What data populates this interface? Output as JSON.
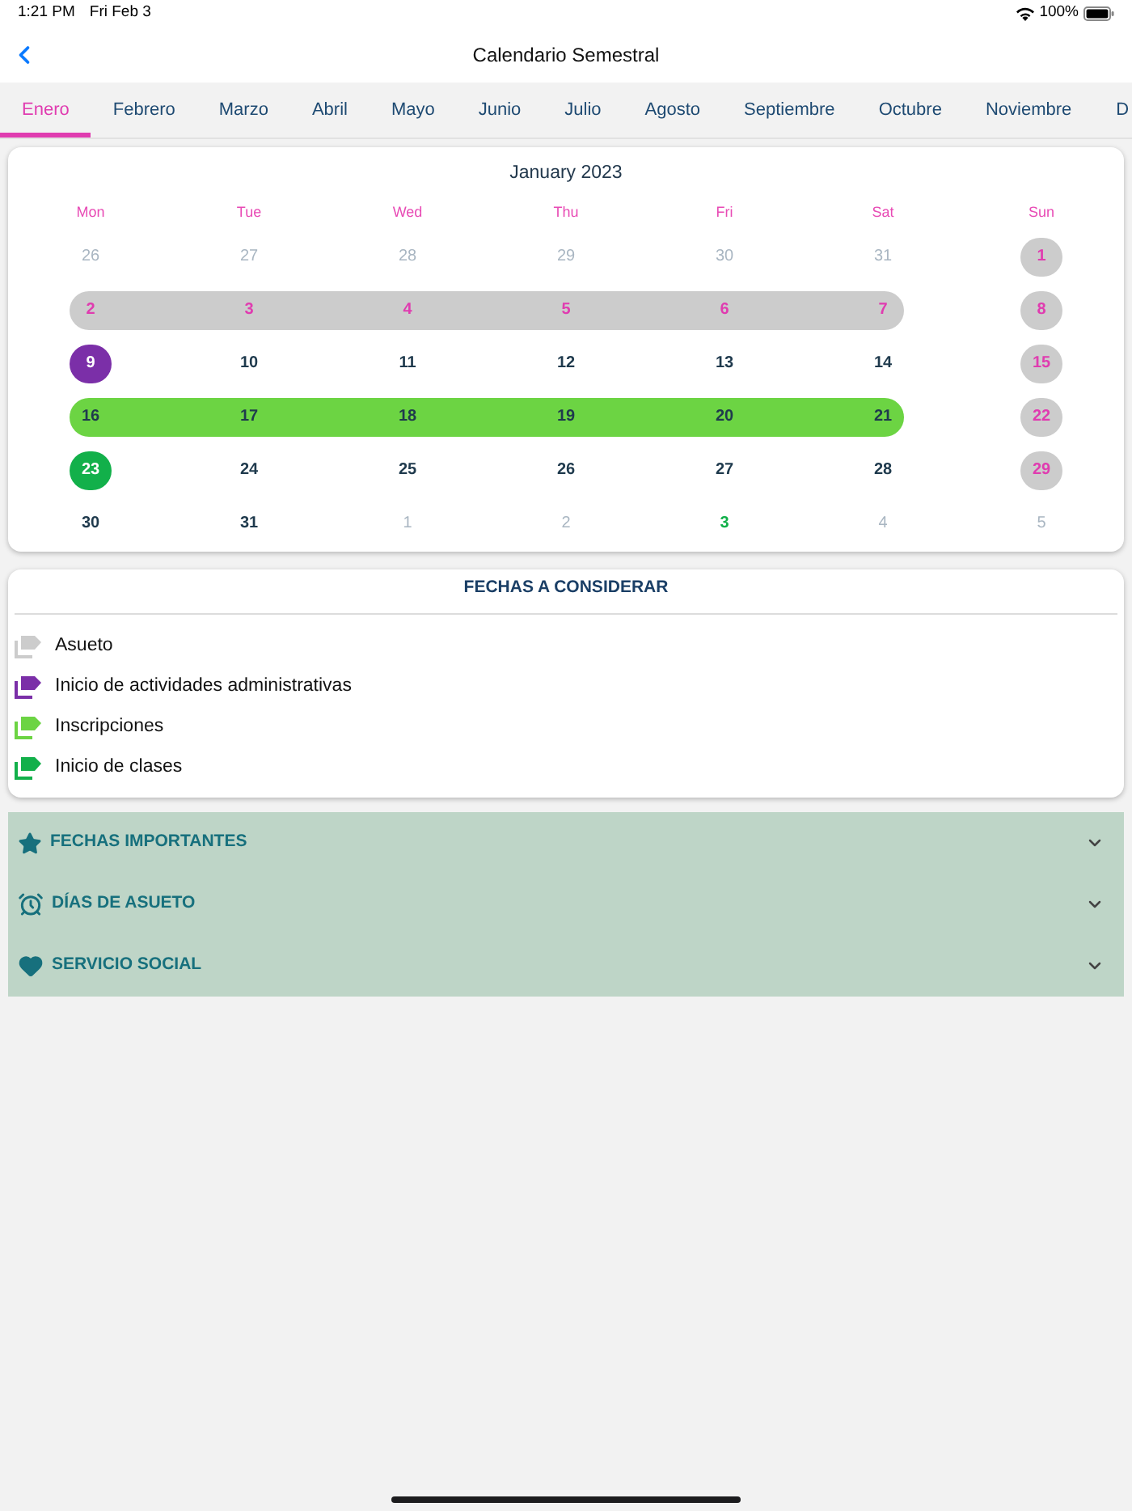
{
  "status_bar": {
    "time": "1:21 PM",
    "date": "Fri Feb 3",
    "battery": "100%"
  },
  "nav": {
    "title": "Calendario Semestral"
  },
  "tabs": [
    {
      "label": "Enero",
      "selected": true
    },
    {
      "label": "Febrero",
      "selected": false
    },
    {
      "label": "Marzo",
      "selected": false
    },
    {
      "label": "Abril",
      "selected": false
    },
    {
      "label": "Mayo",
      "selected": false
    },
    {
      "label": "Junio",
      "selected": false
    },
    {
      "label": "Julio",
      "selected": false
    },
    {
      "label": "Agosto",
      "selected": false
    },
    {
      "label": "Septiembre",
      "selected": false
    },
    {
      "label": "Octubre",
      "selected": false
    },
    {
      "label": "Noviembre",
      "selected": false
    },
    {
      "label": "D",
      "selected": false
    }
  ],
  "calendar": {
    "title": "January 2023",
    "weekdays": [
      "Mon",
      "Tue",
      "Wed",
      "Thu",
      "Fri",
      "Sat",
      "Sun"
    ],
    "weeks": [
      {
        "days": [
          {
            "day": "26",
            "in_month": false
          },
          {
            "day": "27",
            "in_month": false
          },
          {
            "day": "28",
            "in_month": false
          },
          {
            "day": "29",
            "in_month": false
          },
          {
            "day": "30",
            "in_month": false
          },
          {
            "day": "31",
            "in_month": false
          },
          {
            "day": "1",
            "in_month": true,
            "kind": "holiday"
          }
        ]
      },
      {
        "days": [
          {
            "day": "2",
            "in_month": true,
            "kind": "holiday"
          },
          {
            "day": "3",
            "in_month": true,
            "kind": "holiday"
          },
          {
            "day": "4",
            "in_month": true,
            "kind": "holiday"
          },
          {
            "day": "5",
            "in_month": true,
            "kind": "holiday"
          },
          {
            "day": "6",
            "in_month": true,
            "kind": "holiday"
          },
          {
            "day": "7",
            "in_month": true,
            "kind": "holiday"
          },
          {
            "day": "8",
            "in_month": true,
            "kind": "holiday"
          }
        ]
      },
      {
        "days": [
          {
            "day": "9",
            "in_month": true,
            "kind": "admin"
          },
          {
            "day": "10",
            "in_month": true
          },
          {
            "day": "11",
            "in_month": true
          },
          {
            "day": "12",
            "in_month": true
          },
          {
            "day": "13",
            "in_month": true
          },
          {
            "day": "14",
            "in_month": true
          },
          {
            "day": "15",
            "in_month": true,
            "kind": "holiday"
          }
        ]
      },
      {
        "days": [
          {
            "day": "16",
            "in_month": true,
            "kind": "enrollment"
          },
          {
            "day": "17",
            "in_month": true,
            "kind": "enrollment"
          },
          {
            "day": "18",
            "in_month": true,
            "kind": "enrollment"
          },
          {
            "day": "19",
            "in_month": true,
            "kind": "enrollment"
          },
          {
            "day": "20",
            "in_month": true,
            "kind": "enrollment"
          },
          {
            "day": "21",
            "in_month": true,
            "kind": "enrollment"
          },
          {
            "day": "22",
            "in_month": true,
            "kind": "holiday"
          }
        ]
      },
      {
        "days": [
          {
            "day": "23",
            "in_month": true,
            "kind": "classes"
          },
          {
            "day": "24",
            "in_month": true
          },
          {
            "day": "25",
            "in_month": true
          },
          {
            "day": "26",
            "in_month": true
          },
          {
            "day": "27",
            "in_month": true
          },
          {
            "day": "28",
            "in_month": true
          },
          {
            "day": "29",
            "in_month": true,
            "kind": "holiday"
          }
        ]
      },
      {
        "days": [
          {
            "day": "30",
            "in_month": true
          },
          {
            "day": "31",
            "in_month": true
          },
          {
            "day": "1",
            "in_month": false
          },
          {
            "day": "2",
            "in_month": false
          },
          {
            "day": "3",
            "in_month": false,
            "kind": "classes"
          },
          {
            "day": "4",
            "in_month": false
          },
          {
            "day": "5",
            "in_month": false
          }
        ]
      }
    ]
  },
  "legend": {
    "title": "FECHAS A CONSIDERAR",
    "items": [
      {
        "label": "Asueto",
        "kind": "holiday",
        "color": "#cccccc"
      },
      {
        "label": "Inicio de actividades administrativas",
        "kind": "admin",
        "color": "#7b2fa8"
      },
      {
        "label": "Inscripciones",
        "kind": "enrollment",
        "color": "#6cd443"
      },
      {
        "label": "Inicio de clases",
        "kind": "classes",
        "color": "#12b04a"
      }
    ]
  },
  "sections": [
    {
      "label": "FECHAS IMPORTANTES",
      "expanded": false
    },
    {
      "label": "DÍAS DE ASUETO",
      "expanded": false
    },
    {
      "label": "SERVICIO SOCIAL",
      "expanded": false
    }
  ]
}
